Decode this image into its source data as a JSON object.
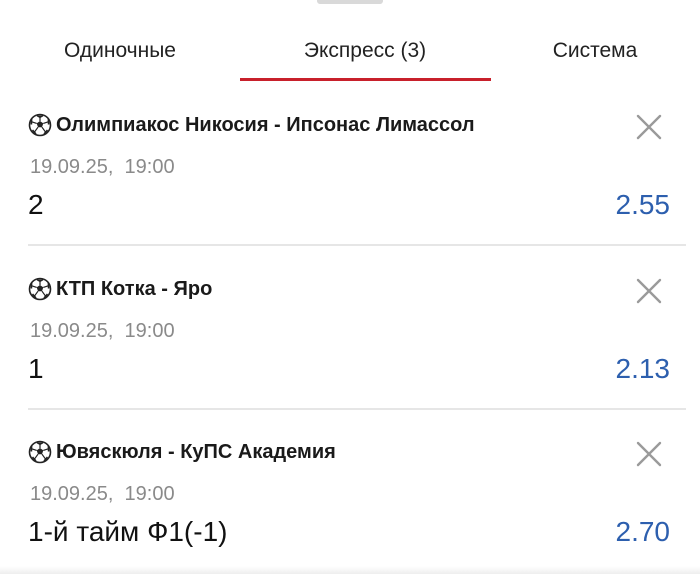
{
  "tabs": [
    {
      "label": "Одиночные",
      "active": false
    },
    {
      "label": "Экспресс (3)",
      "active": true
    },
    {
      "label": "Система",
      "active": false
    }
  ],
  "colors": {
    "accent_underline": "#c8202b",
    "odds": "#2d5fae",
    "date_text": "#8a8a8a"
  },
  "bets": [
    {
      "sport_icon": "soccer-ball-icon",
      "match": "Олимпиакос Никосия - Ипсонас Лимассол",
      "date": "19.09.25,  19:00",
      "outcome": "2",
      "odds": "2.55"
    },
    {
      "sport_icon": "soccer-ball-icon",
      "match": "КТП Котка - Яро",
      "date": "19.09.25,  19:00",
      "outcome": "1",
      "odds": "2.13"
    },
    {
      "sport_icon": "soccer-ball-icon",
      "match": "Ювяскюля - КуПС Академия",
      "date": "19.09.25,  19:00",
      "outcome": "1-й тайм Ф1(-1)",
      "odds": "2.70"
    }
  ]
}
